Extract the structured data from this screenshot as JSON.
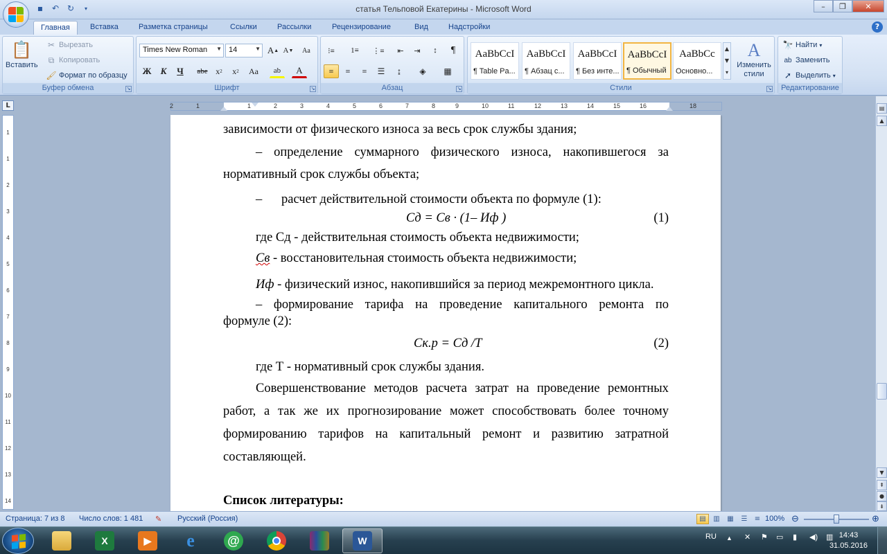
{
  "window": {
    "title": "статья Тельповой Екатерины - Microsoft Word"
  },
  "tabs": [
    "Главная",
    "Вставка",
    "Разметка страницы",
    "Ссылки",
    "Рассылки",
    "Рецензирование",
    "Вид",
    "Надстройки"
  ],
  "ribbon": {
    "clipboard": {
      "label": "Буфер обмена",
      "paste": "Вставить",
      "cut": "Вырезать",
      "copy": "Копировать",
      "format_painter": "Формат по образцу"
    },
    "font": {
      "label": "Шрифт",
      "font_name": "Times New Roman",
      "font_size": "14"
    },
    "paragraph": {
      "label": "Абзац"
    },
    "styles": {
      "label": "Стили",
      "items": [
        {
          "sample": "AaBbCcI",
          "name": "¶ Table Pa..."
        },
        {
          "sample": "AaBbCcI",
          "name": "¶ Абзац с..."
        },
        {
          "sample": "AaBbCcI",
          "name": "¶ Без инте..."
        },
        {
          "sample": "AaBbCcI",
          "name": "¶ Обычный"
        },
        {
          "sample": "AaBbCc",
          "name": "Основно..."
        }
      ],
      "change_styles": "Изменить стили"
    },
    "editing": {
      "label": "Редактирование",
      "find": "Найти",
      "replace": "Заменить",
      "select": "Выделить"
    }
  },
  "ruler": {
    "ticks": [
      "2",
      "1",
      "1",
      "2",
      "3",
      "4",
      "5",
      "6",
      "7",
      "8",
      "9",
      "10",
      "11",
      "12",
      "13",
      "14",
      "15",
      "16",
      "18"
    ],
    "vticks": [
      "1",
      "1",
      "2",
      "3",
      "4",
      "5",
      "6",
      "7",
      "8",
      "9",
      "10",
      "11",
      "12",
      "13",
      "14"
    ],
    "corner": "L"
  },
  "document": {
    "line1": "зависимости от физического износа за весь срок службы здания;",
    "line2_words": [
      "–",
      "определение",
      "суммарного",
      "физического",
      "износа,",
      "накопившегося",
      "за"
    ],
    "line3": "нормативный срок службы объекта;",
    "line4": "–      расчет действительной стоимости объекта по формуле (1):",
    "formula1": "Сд  = Св · (1– Иф )",
    "formula1_num": "(1)",
    "line5": "где Сд - действительная стоимость объекта недвижимости;",
    "line6_sym": "Св",
    "line6": " - восстановительная стоимость объекта недвижимости;",
    "line7_sym": "Иф",
    "line7": " - физический износ, накопившийся за период межремонтного цикла.",
    "line8_words": [
      "–",
      "формирование",
      "тарифа",
      "на",
      "проведение",
      "капитального",
      "ремонта",
      "по"
    ],
    "line9": "формуле (2):",
    "formula2": "Ск.р = Сд /Т",
    "formula2_num": "(2)",
    "line10": "где Т - нормативный срок службы здания.",
    "para1_words": [
      "Совершенствование",
      "методов",
      "расчета",
      "затрат",
      "на",
      "проведение",
      "ремонтных"
    ],
    "para2_words": [
      "работ,",
      "а",
      "так",
      "же",
      "их",
      "прогнозирование",
      "может",
      "способствовать",
      "более",
      "точному"
    ],
    "para3_words": [
      "формированию",
      "тарифов",
      "на",
      "капитальный",
      "ремонт",
      "и",
      "развитию",
      "затратной"
    ],
    "para4": "составляющей.",
    "heading": "Список литературы:"
  },
  "statusbar": {
    "page": "Страница: 7 из 8",
    "words": "Число слов: 1 481",
    "language": "Русский (Россия)",
    "zoom": "100%"
  },
  "taskbar": {
    "lang": "RU",
    "time": "14:43",
    "date": "31.05.2016"
  },
  "colors": {
    "accent": "#15428b",
    "ribbon_bg": "#dce8f7",
    "doc_bg": "#a5b7cf"
  }
}
